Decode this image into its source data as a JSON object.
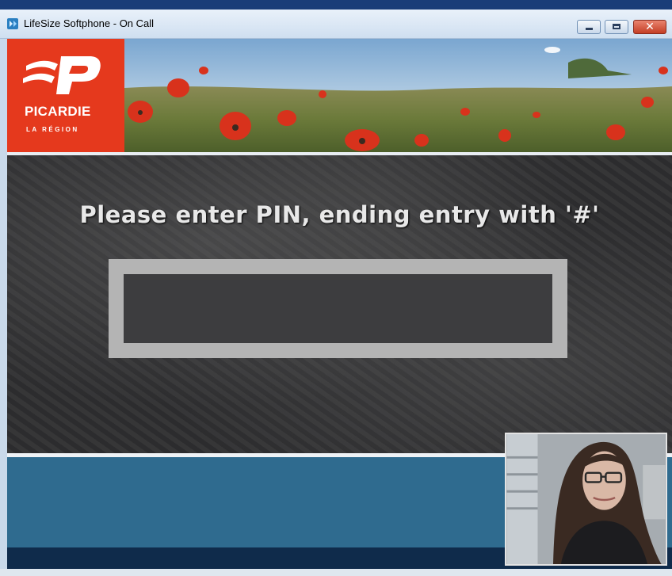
{
  "window": {
    "title": "LifeSize Softphone - On Call",
    "controls": {
      "minimize": "minimize",
      "maximize": "maximize",
      "close": "✕"
    }
  },
  "banner": {
    "logo_name": "PICARDIE",
    "logo_sub": "LA RÉGION"
  },
  "content": {
    "prompt": "Please enter PIN, ending entry with '#'",
    "pin_value": ""
  },
  "colors": {
    "logo_red": "#e5391d",
    "blue_band": "#2f6b8f",
    "navy_band": "#0f2b4b",
    "screen_bg": "#2f2f31"
  },
  "icons": [
    "lifesize-app-icon",
    "minimize-icon",
    "maximize-icon",
    "close-icon",
    "picardie-logo-icon"
  ]
}
